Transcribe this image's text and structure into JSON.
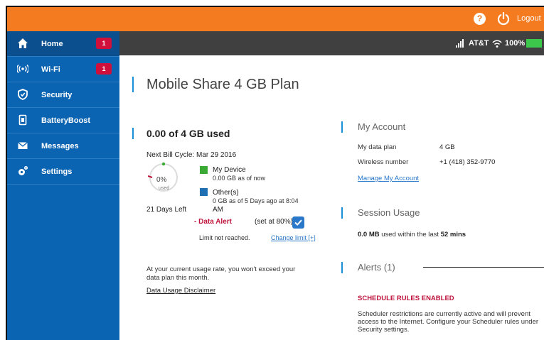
{
  "topbar": {
    "help_glyph": "?",
    "logout_label": "Logout",
    "accent_color": "#f47b20"
  },
  "statusbar": {
    "carrier": "AT&T",
    "battery_pct": "100%"
  },
  "sidebar": {
    "items": [
      {
        "label": "Home",
        "icon": "home-icon",
        "badge": "1",
        "active": true
      },
      {
        "label": "Wi-Fi",
        "icon": "wifi-icon",
        "badge": "1",
        "active": false
      },
      {
        "label": "Security",
        "icon": "shield-icon",
        "badge": null,
        "active": false
      },
      {
        "label": "BatteryBoost",
        "icon": "battery-boost-icon",
        "badge": null,
        "active": false
      },
      {
        "label": "Messages",
        "icon": "envelope-icon",
        "badge": null,
        "active": false
      },
      {
        "label": "Settings",
        "icon": "gear-icon",
        "badge": null,
        "active": false
      }
    ],
    "bg_color": "#0a64b2"
  },
  "main": {
    "title": "Mobile Share 4 GB Plan",
    "usage": {
      "headline": "0.00 of 4 GB used",
      "bill_cycle": "Next Bill Cycle: Mar 29 2016",
      "ring_pct": "0%",
      "ring_sub": "used",
      "used_fraction": 0,
      "days_left": "21 Days Left",
      "legend": [
        {
          "name": "My Device",
          "sub": "0.00 GB as of now",
          "color": "#3aaa35"
        },
        {
          "name": "Other(s)",
          "sub": "0 GB as of 5 Days ago at 8:04",
          "sub2": "AM",
          "color": "#1f6fb3"
        }
      ],
      "alert_label": "- Data Alert",
      "alert_set": "(set at 80%)",
      "alert_checked": true,
      "limit_text": "Limit not reached.",
      "change_limit": "Change limit [+]",
      "rate_text": "At your current usage rate, you won't exceed your data plan this month.",
      "disclaimer": "Data Usage Disclaimer"
    },
    "account": {
      "heading": "My Account",
      "rows": [
        {
          "label": "My data plan",
          "value": "4 GB"
        },
        {
          "label": "Wireless number",
          "value": "+1 (418) 352-9770"
        }
      ],
      "manage_link": "Manage My Account"
    },
    "session": {
      "heading": "Session Usage",
      "amount": "0.0 MB",
      "middle": "used within the last",
      "duration": "52 mins"
    },
    "alerts": {
      "heading": "Alerts (1)",
      "title": "SCHEDULE RULES ENABLED",
      "body": "Scheduler restrictions are currently active and will prevent access to the Internet. Configure your Scheduler rules under Security settings."
    }
  }
}
